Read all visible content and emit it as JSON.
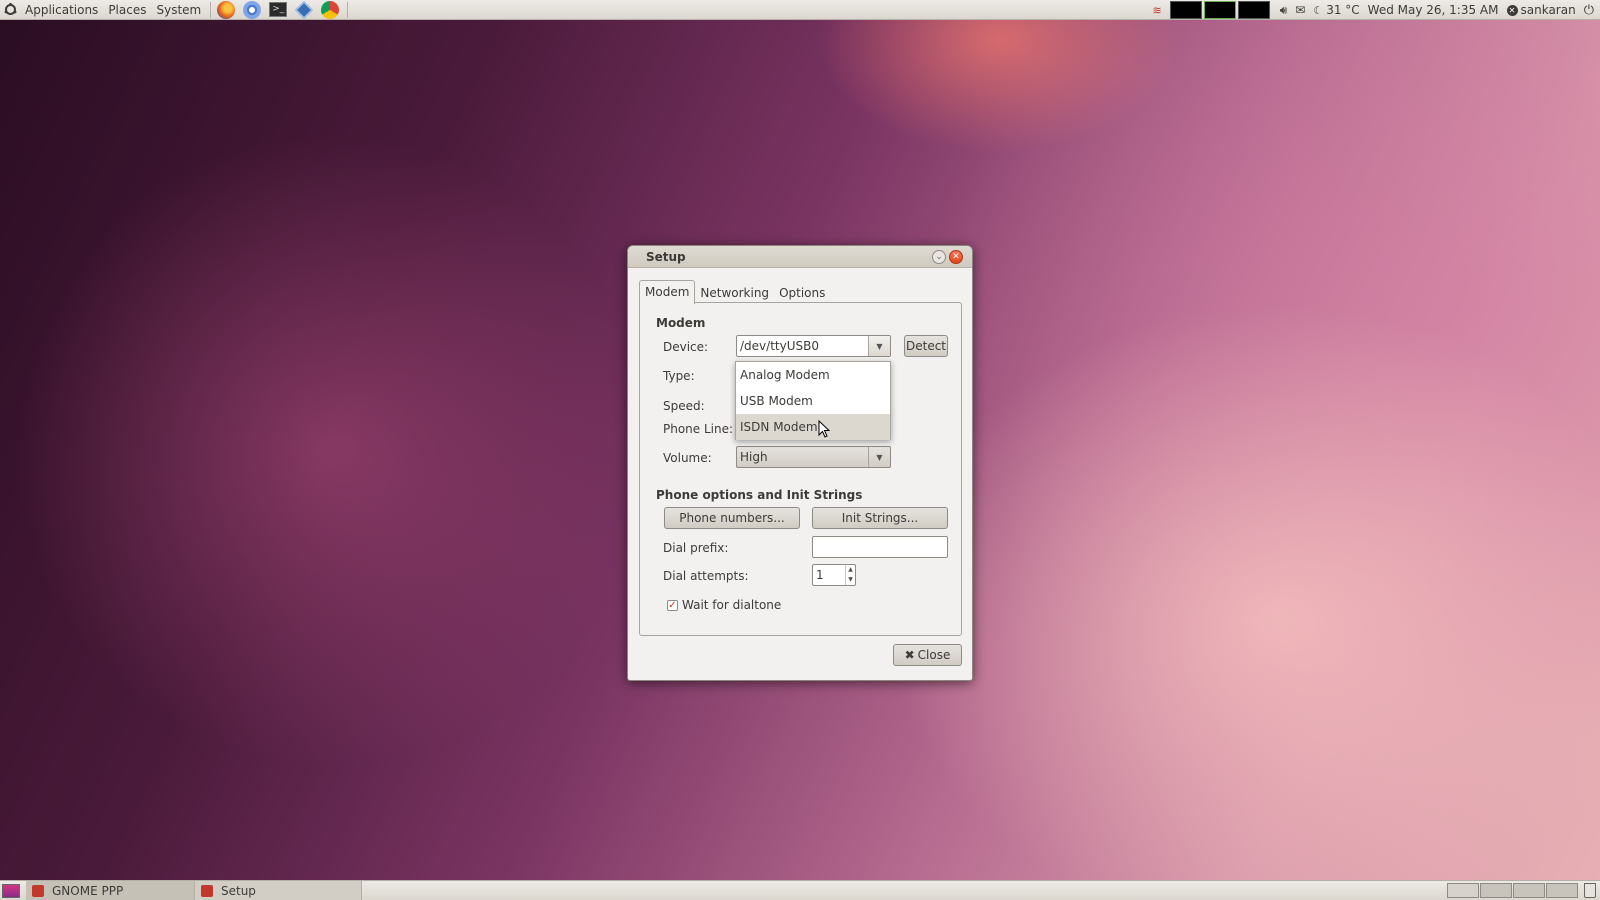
{
  "top_panel": {
    "menus": [
      "Applications",
      "Places",
      "System"
    ],
    "launchers": [
      "firefox-icon",
      "chromium-icon",
      "terminal-icon",
      "virtualbox-icon",
      "chrome-icon"
    ],
    "temperature": "31 °C",
    "datetime": "Wed May 26,  1:35 AM",
    "user": "sankaran"
  },
  "dialog": {
    "title": "Setup",
    "tabs": [
      "Modem",
      "Networking",
      "Options"
    ],
    "active_tab": "Modem",
    "modem_section": "Modem",
    "device_label": "Device:",
    "device_value": "/dev/ttyUSB0",
    "detect_label": "Detect",
    "type_label": "Type:",
    "speed_label": "Speed:",
    "phone_line_label": "Phone Line:",
    "volume_label": "Volume:",
    "volume_value": "High",
    "phone_section": "Phone options and Init Strings",
    "phone_numbers_button": "Phone numbers...",
    "init_strings_button": "Init Strings...",
    "dial_prefix_label": "Dial prefix:",
    "dial_prefix_value": "",
    "dial_attempts_label": "Dial attempts:",
    "dial_attempts_value": "1",
    "wait_dialtone_label": "Wait for dialtone",
    "wait_dialtone_checked": true,
    "close_label": "Close"
  },
  "type_dropdown": {
    "options": [
      "Analog Modem",
      "USB Modem",
      "ISDN Modem"
    ],
    "hovered": "ISDN Modem"
  },
  "bottom_panel": {
    "tasks": [
      "GNOME PPP",
      "Setup"
    ]
  }
}
